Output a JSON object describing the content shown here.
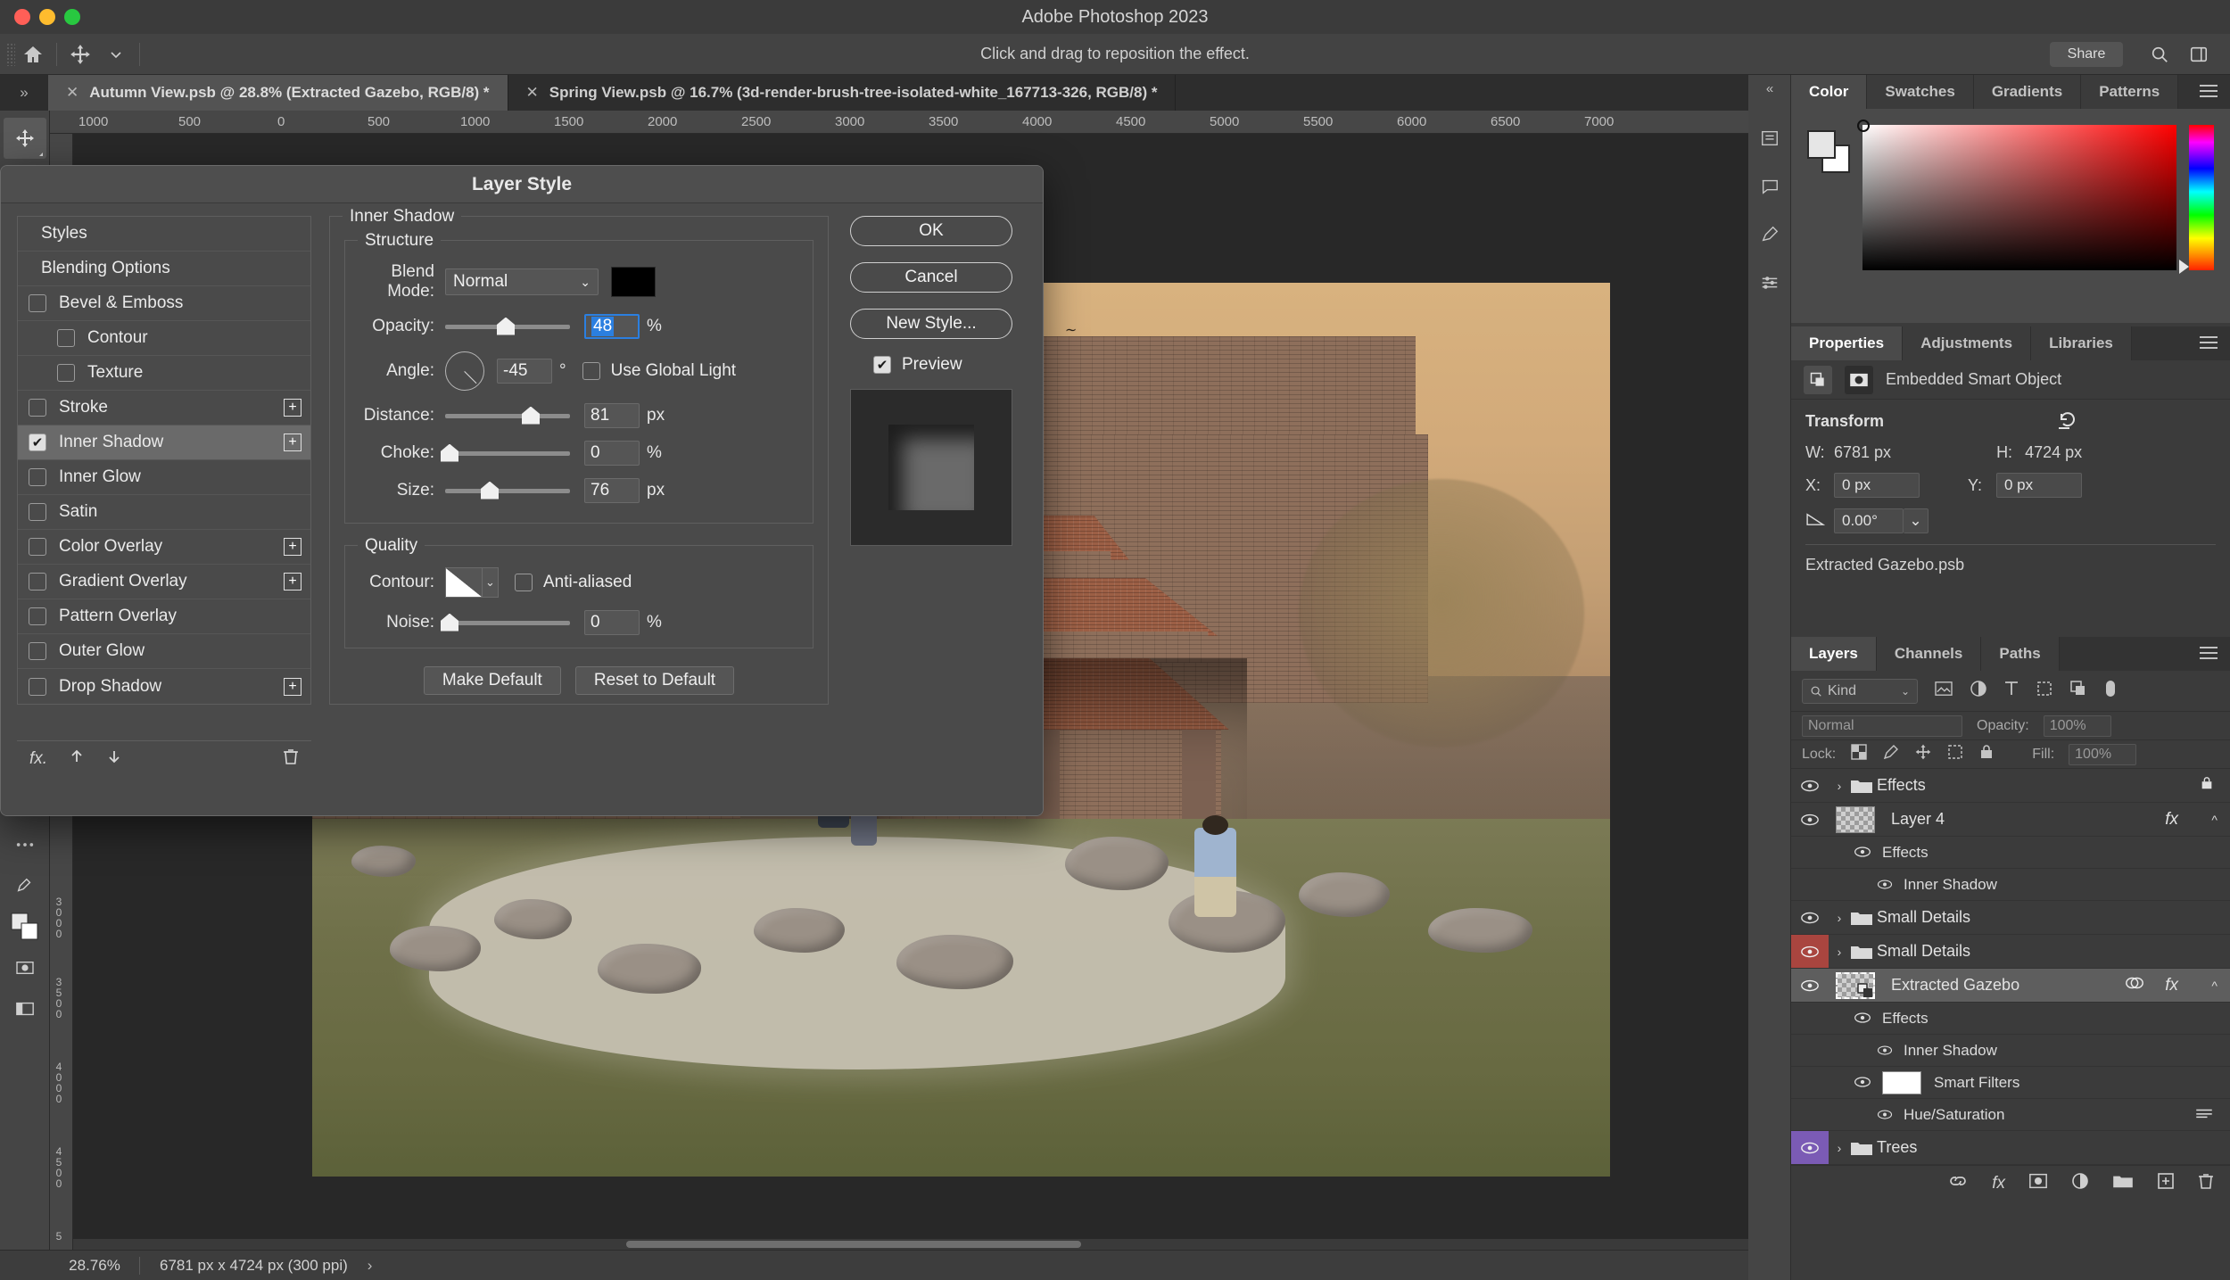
{
  "app": {
    "title": "Adobe Photoshop 2023",
    "options_hint": "Click and drag to reposition the effect.",
    "share_label": "Share"
  },
  "tabs": [
    {
      "label": "Autumn View.psb @ 28.8% (Extracted Gazebo, RGB/8) *",
      "active": true
    },
    {
      "label": "Spring View.psb @ 16.7% (3d-render-brush-tree-isolated-white_167713-326, RGB/8) *",
      "active": false
    }
  ],
  "rulers": {
    "top_labels": [
      "1000",
      "500",
      "0",
      "500",
      "1000",
      "1500",
      "2000",
      "2500",
      "3000",
      "3500",
      "4000",
      "4500",
      "5000",
      "5500",
      "6000",
      "6500",
      "7000"
    ],
    "left_labels": [
      "3 0 0 0",
      "3 5 0 0",
      "4 0 0 0",
      "4 5 0 0",
      "5"
    ]
  },
  "status": {
    "zoom": "28.76%",
    "doc_size": "6781 px x 4724 px (300 ppi)",
    "arrow": "›"
  },
  "dialog": {
    "title": "Layer Style",
    "styles_list": [
      {
        "label": "Styles",
        "type": "header",
        "checked": null,
        "plus": false,
        "indent": false,
        "active": false
      },
      {
        "label": "Blending Options",
        "type": "header",
        "checked": null,
        "plus": false,
        "indent": false,
        "active": false
      },
      {
        "label": "Bevel & Emboss",
        "type": "effect",
        "checked": false,
        "plus": false,
        "indent": false,
        "active": false
      },
      {
        "label": "Contour",
        "type": "effect",
        "checked": false,
        "plus": false,
        "indent": true,
        "active": false
      },
      {
        "label": "Texture",
        "type": "effect",
        "checked": false,
        "plus": false,
        "indent": true,
        "active": false
      },
      {
        "label": "Stroke",
        "type": "effect",
        "checked": false,
        "plus": true,
        "indent": false,
        "active": false
      },
      {
        "label": "Inner Shadow",
        "type": "effect",
        "checked": true,
        "plus": true,
        "indent": false,
        "active": true
      },
      {
        "label": "Inner Glow",
        "type": "effect",
        "checked": false,
        "plus": false,
        "indent": false,
        "active": false
      },
      {
        "label": "Satin",
        "type": "effect",
        "checked": false,
        "plus": false,
        "indent": false,
        "active": false
      },
      {
        "label": "Color Overlay",
        "type": "effect",
        "checked": false,
        "plus": true,
        "indent": false,
        "active": false
      },
      {
        "label": "Gradient Overlay",
        "type": "effect",
        "checked": false,
        "plus": true,
        "indent": false,
        "active": false
      },
      {
        "label": "Pattern Overlay",
        "type": "effect",
        "checked": false,
        "plus": false,
        "indent": false,
        "active": false
      },
      {
        "label": "Outer Glow",
        "type": "effect",
        "checked": false,
        "plus": false,
        "indent": false,
        "active": false
      },
      {
        "label": "Drop Shadow",
        "type": "effect",
        "checked": false,
        "plus": true,
        "indent": false,
        "active": false
      }
    ],
    "section_title": "Inner Shadow",
    "structure": {
      "legend": "Structure",
      "blend_mode_label": "Blend Mode:",
      "blend_mode_value": "Normal",
      "shadow_color": "#000000",
      "opacity_label": "Opacity:",
      "opacity_value": "48",
      "opacity_unit": "%",
      "angle_label": "Angle:",
      "angle_value": "-45",
      "angle_unit": "°",
      "use_global_light_label": "Use Global Light",
      "use_global_light_checked": false,
      "distance_label": "Distance:",
      "distance_value": "81",
      "distance_unit": "px",
      "choke_label": "Choke:",
      "choke_value": "0",
      "choke_unit": "%",
      "size_label": "Size:",
      "size_value": "76",
      "size_unit": "px"
    },
    "quality": {
      "legend": "Quality",
      "contour_label": "Contour:",
      "anti_aliased_label": "Anti-aliased",
      "anti_aliased_checked": false,
      "noise_label": "Noise:",
      "noise_value": "0",
      "noise_unit": "%"
    },
    "make_default_label": "Make Default",
    "reset_default_label": "Reset to Default",
    "ok_label": "OK",
    "cancel_label": "Cancel",
    "new_style_label": "New Style...",
    "preview_label": "Preview",
    "preview_checked": true
  },
  "color_panel": {
    "tabs": [
      "Color",
      "Swatches",
      "Gradients",
      "Patterns"
    ],
    "active_tab": "Color",
    "foreground": "#e6e6e6",
    "background": "#ffffff",
    "hue": "#ff0000"
  },
  "properties_panel": {
    "tabs": [
      "Properties",
      "Adjustments",
      "Libraries"
    ],
    "active_tab": "Properties",
    "object_type": "Embedded Smart Object",
    "transform_title": "Transform",
    "w_label": "W:",
    "w_value": "6781 px",
    "h_label": "H:",
    "h_value": "4724 px",
    "x_label": "X:",
    "x_value": "0 px",
    "y_label": "Y:",
    "y_value": "0 px",
    "angle_value": "0.00°",
    "filename": "Extracted Gazebo.psb"
  },
  "layers_panel": {
    "tabs": [
      "Layers",
      "Channels",
      "Paths"
    ],
    "active_tab": "Layers",
    "kind_label": "Kind",
    "blend_mode": "Normal",
    "opacity_label": "Opacity:",
    "opacity_value": "100%",
    "lock_label": "Lock:",
    "fill_label": "Fill:",
    "fill_value": "100%",
    "rows": [
      {
        "name": "Effects",
        "kind": "group",
        "visible": true,
        "selected": false,
        "locked": true,
        "eye_tint": "none",
        "has_fx": false
      },
      {
        "name": "Layer 4",
        "kind": "layer",
        "visible": true,
        "selected": false,
        "locked": false,
        "eye_tint": "none",
        "has_fx": true,
        "children": [
          {
            "name": "Effects",
            "kind": "fx-group"
          },
          {
            "name": "Inner Shadow",
            "kind": "fx"
          }
        ]
      },
      {
        "name": "Small Details",
        "kind": "group",
        "visible": true,
        "selected": false,
        "locked": false,
        "eye_tint": "none",
        "has_fx": false
      },
      {
        "name": "Small Details",
        "kind": "group",
        "visible": true,
        "selected": false,
        "locked": false,
        "eye_tint": "#a9453f",
        "has_fx": false
      },
      {
        "name": "Extracted Gazebo",
        "kind": "smart-object",
        "visible": true,
        "selected": true,
        "locked": false,
        "eye_tint": "none",
        "has_fx": true,
        "children": [
          {
            "name": "Effects",
            "kind": "fx-group"
          },
          {
            "name": "Inner Shadow",
            "kind": "fx"
          },
          {
            "name": "Smart Filters",
            "kind": "smart-filters"
          },
          {
            "name": "Hue/Saturation",
            "kind": "filter"
          }
        ]
      },
      {
        "name": "Trees",
        "kind": "group",
        "visible": true,
        "selected": false,
        "locked": false,
        "eye_tint": "#7b5bb5",
        "has_fx": false
      }
    ]
  }
}
